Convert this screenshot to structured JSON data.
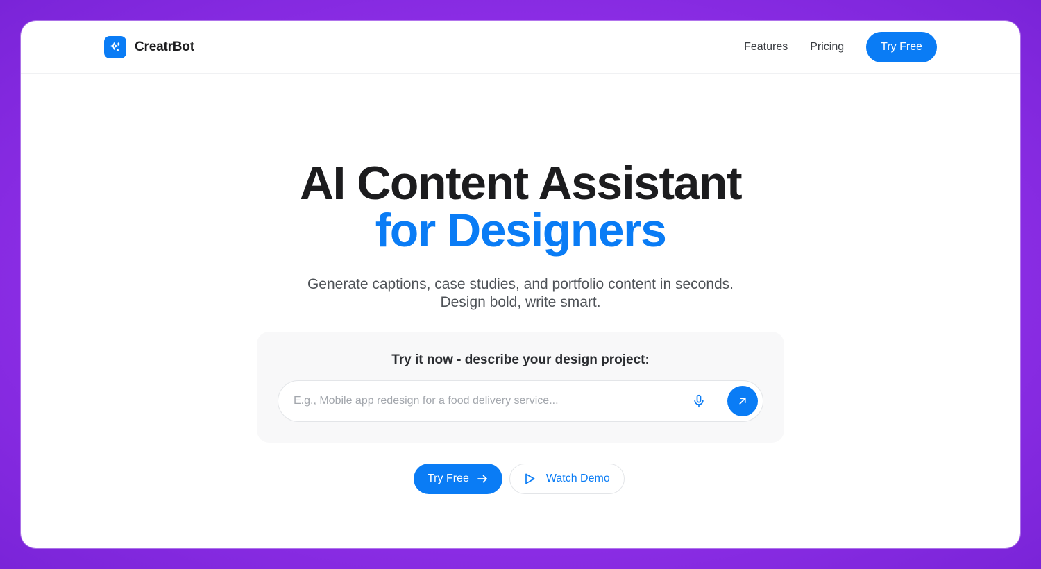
{
  "brand": {
    "name": "CreatrBot",
    "logo_icon": "sparkle-icon"
  },
  "nav": {
    "links": [
      "Features",
      "Pricing"
    ],
    "cta_label": "Try Free"
  },
  "hero": {
    "title_line1": "AI Content Assistant",
    "title_line2": "for Designers",
    "subtitle_line1": "Generate captions, case studies, and portfolio content in seconds.",
    "subtitle_line2": "Design bold, write smart."
  },
  "prompt": {
    "title": "Try it now - describe your design project:",
    "input_value": "",
    "placeholder": "E.g., Mobile app redesign for a food delivery service...",
    "mic_icon": "microphone-icon",
    "send_icon": "arrow-up-right-icon"
  },
  "cta": {
    "try_label": "Try Free",
    "try_icon": "arrow-right-icon",
    "demo_label": "Watch Demo",
    "demo_icon": "play-icon"
  },
  "colors": {
    "accent": "#0a7cf5",
    "heading": "#1c1c1e",
    "frame_background": "#8d2ee6"
  }
}
